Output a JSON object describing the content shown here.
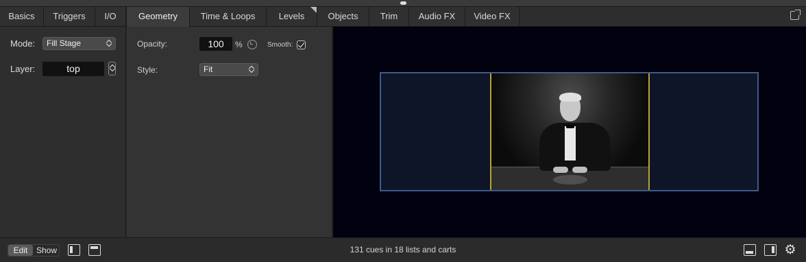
{
  "tabs": [
    {
      "label": "Basics",
      "active": false
    },
    {
      "label": "Triggers",
      "active": false
    },
    {
      "label": "I/O",
      "active": false
    },
    {
      "label": "Geometry",
      "active": true
    },
    {
      "label": "Time & Loops",
      "active": false
    },
    {
      "label": "Levels",
      "active": false
    },
    {
      "label": "Objects",
      "active": false
    },
    {
      "label": "Trim",
      "active": false
    },
    {
      "label": "Audio FX",
      "active": false
    },
    {
      "label": "Video FX",
      "active": false
    }
  ],
  "left_panel": {
    "mode_label": "Mode:",
    "mode_value": "Fill Stage",
    "layer_label": "Layer:",
    "layer_value": "top"
  },
  "geometry": {
    "opacity_label": "Opacity:",
    "opacity_value": "100",
    "opacity_unit": "%",
    "smooth_label": "Smooth:",
    "smooth_checked": true,
    "style_label": "Style:",
    "style_value": "Fit"
  },
  "footer": {
    "edit_label": "Edit",
    "show_label": "Show",
    "status_text": "131 cues in 18 lists and carts"
  },
  "colors": {
    "stage_border": "#3e5a8c",
    "video_border": "#b8a535",
    "preview_bg": "#01010f"
  }
}
